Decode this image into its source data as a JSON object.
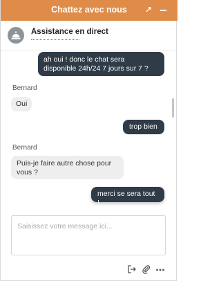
{
  "header": {
    "title": "Chattez avec nous",
    "expand_icon": "↗",
    "minimize_icon": "minimize"
  },
  "agent": {
    "name": "Assistance en direct",
    "avatar_icon": "service-bell-icon"
  },
  "messages": [
    {
      "from": "visitor",
      "text_line1": "ah oui ! donc le chat sera",
      "text_line2": "disponible 24h/24 7 jours sur 7 ?"
    },
    {
      "from": "agent",
      "sender": "Bernard",
      "text": "Oui"
    },
    {
      "from": "visitor",
      "text": "trop bien"
    },
    {
      "from": "agent",
      "sender": "Bernard",
      "text_line1": "Puis-je faire autre chose pour",
      "text_line2": "vous ?"
    },
    {
      "from": "visitor",
      "text": "merci se sera tout !"
    }
  ],
  "composer": {
    "placeholder": "Saisissez votre message ici..."
  },
  "toolbar": {
    "icons": [
      "exit-icon",
      "paperclip-icon",
      "more-icon"
    ]
  },
  "colors": {
    "header_bg": "#de8c47",
    "outgoing_bubble": "#2f3b47",
    "incoming_bubble": "#eeeeef"
  }
}
